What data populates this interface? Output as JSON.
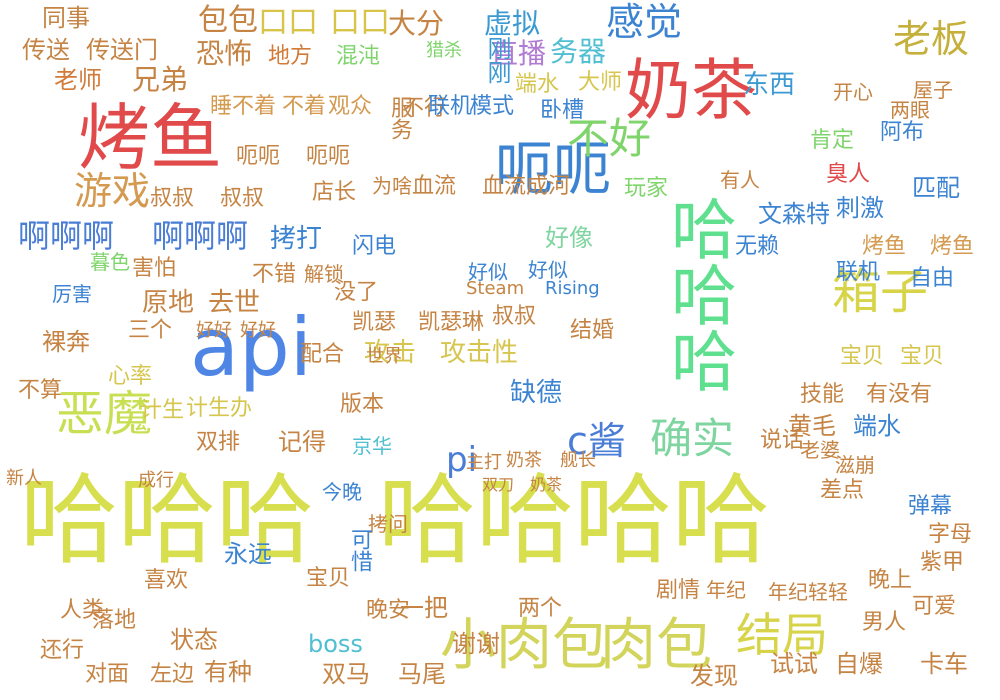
{
  "words": [
    {
      "text": "哈哈哈",
      "color": "#d8df4e"
    },
    {
      "text": "哈哈哈哈",
      "color": "#d8df4e"
    },
    {
      "text": "哈哈哈",
      "color": "#5fe08f"
    },
    {
      "text": "api",
      "color": "#4f86e6"
    },
    {
      "text": "烤鱼",
      "color": "#e14a4a"
    },
    {
      "text": "奶茶",
      "color": "#e14a4a"
    },
    {
      "text": "小肉包",
      "color": "#d2d45c"
    },
    {
      "text": "肉包",
      "color": "#d2d45c"
    },
    {
      "text": "呃呃",
      "color": "#3c84d2"
    },
    {
      "text": "箱子",
      "color": "#d7d44a"
    },
    {
      "text": "恶魔",
      "color": "#c9df53"
    },
    {
      "text": "游戏",
      "color": "#d49a50"
    },
    {
      "text": "结局",
      "color": "#d7d44a"
    },
    {
      "text": "确实",
      "color": "#7fd5a0"
    },
    {
      "text": "不好",
      "color": "#7fd56c"
    },
    {
      "text": "感觉",
      "color": "#3c84d2"
    },
    {
      "text": "老板",
      "color": "#c6b03c"
    },
    {
      "text": "啊啊啊",
      "color": "#4a7dd6"
    },
    {
      "text": "啊啊啊",
      "color": "#4a7dd6"
    },
    {
      "text": "c酱",
      "color": "#4a7dd6"
    },
    {
      "text": "pi",
      "color": "#4a7dd6"
    },
    {
      "text": "口口",
      "color": "#d8c448"
    },
    {
      "text": "口口",
      "color": "#d8c448"
    },
    {
      "text": "同事",
      "color": "#c58444"
    },
    {
      "text": "包包",
      "color": "#c58444"
    },
    {
      "text": "大分",
      "color": "#c58444"
    },
    {
      "text": "直播",
      "color": "#b07bd2"
    },
    {
      "text": "虚拟",
      "color": "#3c9ad2"
    },
    {
      "text": "传送",
      "color": "#c58444"
    },
    {
      "text": "传送门",
      "color": "#c58444"
    },
    {
      "text": "恐怖",
      "color": "#c58444"
    },
    {
      "text": "兄弟",
      "color": "#c58444"
    },
    {
      "text": "老师",
      "color": "#d27a38"
    },
    {
      "text": "地方",
      "color": "#d27a38"
    },
    {
      "text": "混沌",
      "color": "#7fd56c"
    },
    {
      "text": "猎杀",
      "color": "#7fd56c"
    },
    {
      "text": "刚刚",
      "color": "#3c9ad2"
    },
    {
      "text": "务器",
      "color": "#4fbfd1"
    },
    {
      "text": "大师",
      "color": "#d6c64e"
    },
    {
      "text": "端水",
      "color": "#d6c64e"
    },
    {
      "text": "不行",
      "color": "#c58444"
    },
    {
      "text": "联机",
      "color": "#3c84d2"
    },
    {
      "text": "模式",
      "color": "#3c84d2"
    },
    {
      "text": "卧槽",
      "color": "#3c84d2"
    },
    {
      "text": "服务",
      "color": "#c58444"
    },
    {
      "text": "东西",
      "color": "#3c9ad2"
    },
    {
      "text": "两眼",
      "color": "#c58444"
    },
    {
      "text": "阿布",
      "color": "#3c84d2"
    },
    {
      "text": "屋子",
      "color": "#c58444"
    },
    {
      "text": "开心",
      "color": "#c58444"
    },
    {
      "text": "肯定",
      "color": "#7fd56c"
    },
    {
      "text": "臭人",
      "color": "#e14a4a"
    },
    {
      "text": "刺激",
      "color": "#3c84d2"
    },
    {
      "text": "匹配",
      "color": "#3c84d2"
    },
    {
      "text": "睡不着",
      "color": "#d49a50"
    },
    {
      "text": "不着",
      "color": "#d49a50"
    },
    {
      "text": "观众",
      "color": "#d49a50"
    },
    {
      "text": "呃呃",
      "color": "#c58444"
    },
    {
      "text": "呃呃",
      "color": "#c58444"
    },
    {
      "text": "叔叔",
      "color": "#c58444"
    },
    {
      "text": "叔叔",
      "color": "#c58444"
    },
    {
      "text": "店长",
      "color": "#c58444"
    },
    {
      "text": "血流",
      "color": "#c58444"
    },
    {
      "text": "血流成河",
      "color": "#c58444"
    },
    {
      "text": "玩家",
      "color": "#7fd56c"
    },
    {
      "text": "拷打",
      "color": "#3c84d2"
    },
    {
      "text": "闪电",
      "color": "#3c84d2"
    },
    {
      "text": "好像",
      "color": "#7fd5a0"
    },
    {
      "text": "无赖",
      "color": "#3c84d2"
    },
    {
      "text": "文森特",
      "color": "#3c84d2"
    },
    {
      "text": "烤鱼",
      "color": "#d49a50"
    },
    {
      "text": "烤鱼",
      "color": "#d49a50"
    },
    {
      "text": "害怕",
      "color": "#c58444"
    },
    {
      "text": "原地",
      "color": "#c58444"
    },
    {
      "text": "去世",
      "color": "#c58444"
    },
    {
      "text": "暮色",
      "color": "#7fd56c"
    },
    {
      "text": "厉害",
      "color": "#3c84d2"
    },
    {
      "text": "好似",
      "color": "#3c84d2"
    },
    {
      "text": "好似",
      "color": "#3c84d2"
    },
    {
      "text": "凯瑟",
      "color": "#c58444"
    },
    {
      "text": "凯瑟琳",
      "color": "#c58444"
    },
    {
      "text": "叔叔",
      "color": "#c58444"
    },
    {
      "text": "没了",
      "color": "#c58444"
    },
    {
      "text": "结婚",
      "color": "#c58444"
    },
    {
      "text": "联机",
      "color": "#3c84d2"
    },
    {
      "text": "自由",
      "color": "#3c84d2"
    },
    {
      "text": "宝贝",
      "color": "#d6c64e"
    },
    {
      "text": "宝贝",
      "color": "#d6c64e"
    },
    {
      "text": "技能",
      "color": "#c58444"
    },
    {
      "text": "有没有",
      "color": "#c58444"
    },
    {
      "text": "攻击",
      "color": "#d6c64e"
    },
    {
      "text": "攻击性",
      "color": "#d6c64e"
    },
    {
      "text": "缺德",
      "color": "#3c84d2"
    },
    {
      "text": "世界",
      "color": "#c58444"
    },
    {
      "text": "配合",
      "color": "#c58444"
    },
    {
      "text": "版本",
      "color": "#c58444"
    },
    {
      "text": "计生",
      "color": "#d6c64e"
    },
    {
      "text": "计生办",
      "color": "#d6c64e"
    },
    {
      "text": "心率",
      "color": "#d6c64e"
    },
    {
      "text": "双排",
      "color": "#c58444"
    },
    {
      "text": "记得",
      "color": "#c58444"
    },
    {
      "text": "黄毛",
      "color": "#c58444"
    },
    {
      "text": "端水",
      "color": "#3c84d2"
    },
    {
      "text": "说话",
      "color": "#c58444"
    },
    {
      "text": "老婆",
      "color": "#c58444"
    },
    {
      "text": "滋崩",
      "color": "#c58444"
    },
    {
      "text": "京华",
      "color": "#4fbfd1"
    },
    {
      "text": "主打",
      "color": "#c58444"
    },
    {
      "text": "奶茶",
      "color": "#c58444"
    },
    {
      "text": "舰长",
      "color": "#c58444"
    },
    {
      "text": "今晚",
      "color": "#3c84d2"
    },
    {
      "text": "拷问",
      "color": "#c58444"
    },
    {
      "text": "可惜",
      "color": "#3c84d2"
    },
    {
      "text": "永远",
      "color": "#3c84d2"
    },
    {
      "text": "喜欢",
      "color": "#c58444"
    },
    {
      "text": "双刀",
      "color": "#c58444"
    },
    {
      "text": "奶茶",
      "color": "#c58444"
    },
    {
      "text": "差点",
      "color": "#c58444"
    },
    {
      "text": "弹幕",
      "color": "#3c84d2"
    },
    {
      "text": "字母",
      "color": "#c58444"
    },
    {
      "text": "紫甲",
      "color": "#c58444"
    },
    {
      "text": "宝贝",
      "color": "#c58444"
    },
    {
      "text": "晚安",
      "color": "#c58444"
    },
    {
      "text": "两个",
      "color": "#c58444"
    },
    {
      "text": "剧情",
      "color": "#c58444"
    },
    {
      "text": "男人",
      "color": "#c58444"
    },
    {
      "text": "可爱",
      "color": "#c58444"
    },
    {
      "text": "年纪",
      "color": "#c58444"
    },
    {
      "text": "年纪轻轻",
      "color": "#c58444"
    },
    {
      "text": "晚上",
      "color": "#c58444"
    },
    {
      "text": "boss",
      "color": "#4fbfd1"
    },
    {
      "text": "谢谢",
      "color": "#c58444"
    },
    {
      "text": "一把",
      "color": "#c58444"
    },
    {
      "text": "状态",
      "color": "#c58444"
    },
    {
      "text": "有种",
      "color": "#c58444"
    },
    {
      "text": "双马",
      "color": "#c58444"
    },
    {
      "text": "马尾",
      "color": "#c58444"
    },
    {
      "text": "发现",
      "color": "#c58444"
    },
    {
      "text": "试试",
      "color": "#c58444"
    },
    {
      "text": "自爆",
      "color": "#c58444"
    },
    {
      "text": "卡车",
      "color": "#c58444"
    },
    {
      "text": "还行",
      "color": "#c58444"
    },
    {
      "text": "对面",
      "color": "#c58444"
    },
    {
      "text": "左边",
      "color": "#c58444"
    },
    {
      "text": "落地",
      "color": "#c58444"
    },
    {
      "text": "人类",
      "color": "#c58444"
    },
    {
      "text": "裸奔",
      "color": "#c58444"
    },
    {
      "text": "三个",
      "color": "#c58444"
    },
    {
      "text": "好好",
      "color": "#c58444"
    },
    {
      "text": "好好",
      "color": "#c58444"
    },
    {
      "text": "不错",
      "color": "#c58444"
    },
    {
      "text": "解锁",
      "color": "#c58444"
    },
    {
      "text": "Steam",
      "color": "#c58444"
    },
    {
      "text": "Rising",
      "color": "#3c84d2"
    },
    {
      "text": "为啥",
      "color": "#c58444"
    },
    {
      "text": "有人",
      "color": "#c58444"
    },
    {
      "text": "不算",
      "color": "#c58444"
    },
    {
      "text": "新人",
      "color": "#c58444"
    },
    {
      "text": "成行",
      "color": "#c58444"
    }
  ]
}
